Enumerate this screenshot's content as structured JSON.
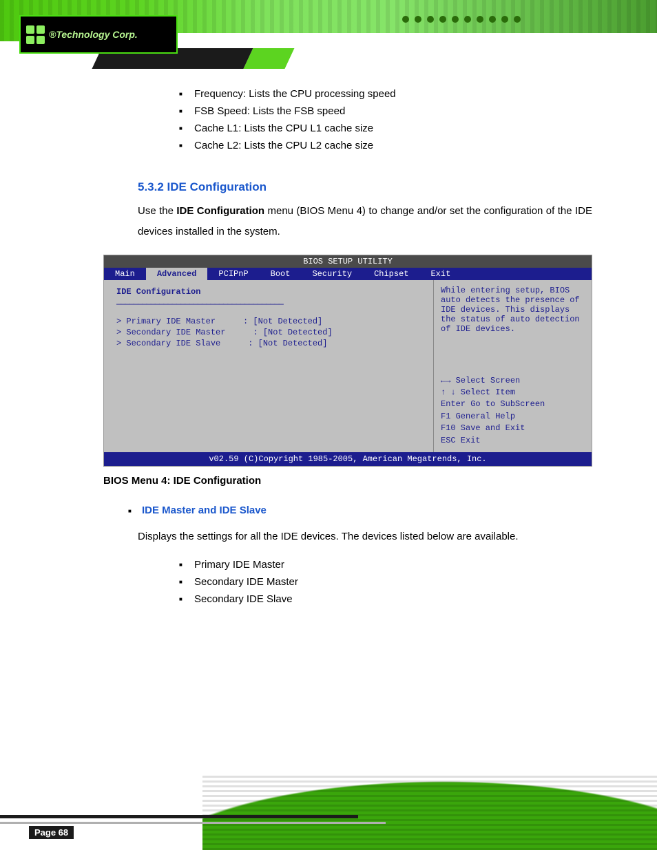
{
  "logo": {
    "text": "®Technology Corp."
  },
  "top_list": [
    "Frequency: Lists the CPU processing speed",
    "FSB Speed: Lists the FSB speed",
    "Cache L1: Lists the CPU L1 cache size",
    "Cache L2: Lists the CPU L2 cache size"
  ],
  "section": {
    "heading": "5.3.2 IDE Configuration",
    "intro_pre": "Use the ",
    "intro_bold": "IDE Configuration",
    "intro_post": " menu (BIOS Menu 4) to change and/or set the configuration of the IDE devices installed in the system."
  },
  "bios": {
    "title": "BIOS SETUP UTILITY",
    "tabs": [
      "Main",
      "Advanced",
      "PCIPnP",
      "Boot",
      "Security",
      "Chipset",
      "Exit"
    ],
    "active_tab_index": 1,
    "heading": "IDE Configuration",
    "items": [
      {
        "label": "> Primary IDE Master",
        "value": ": [Not Detected]"
      },
      {
        "label": "> Secondary IDE Master",
        "value": ": [Not Detected]"
      },
      {
        "label": "> Secondary IDE Slave",
        "value": ": [Not Detected]"
      }
    ],
    "help": "While entering setup, BIOS auto detects the presence of IDE devices. This displays the status of auto detection of IDE devices.",
    "keys": [
      "←→    Select Screen",
      "↑ ↓    Select Item",
      "Enter  Go to SubScreen",
      "F1     General Help",
      "F10    Save and Exit",
      "ESC    Exit"
    ],
    "footer": "v02.59 (C)Copyright 1985-2005, American Megatrends, Inc.",
    "caption": "BIOS Menu 4: IDE Configuration"
  },
  "ide_master": {
    "heading": "IDE Master and IDE Slave",
    "desc": "Displays the settings for all the IDE devices. The devices listed below are available.",
    "sub": [
      "Primary IDE Master",
      "Secondary IDE Master",
      "Secondary IDE Slave"
    ]
  },
  "footer": {
    "page": "Page 68"
  }
}
